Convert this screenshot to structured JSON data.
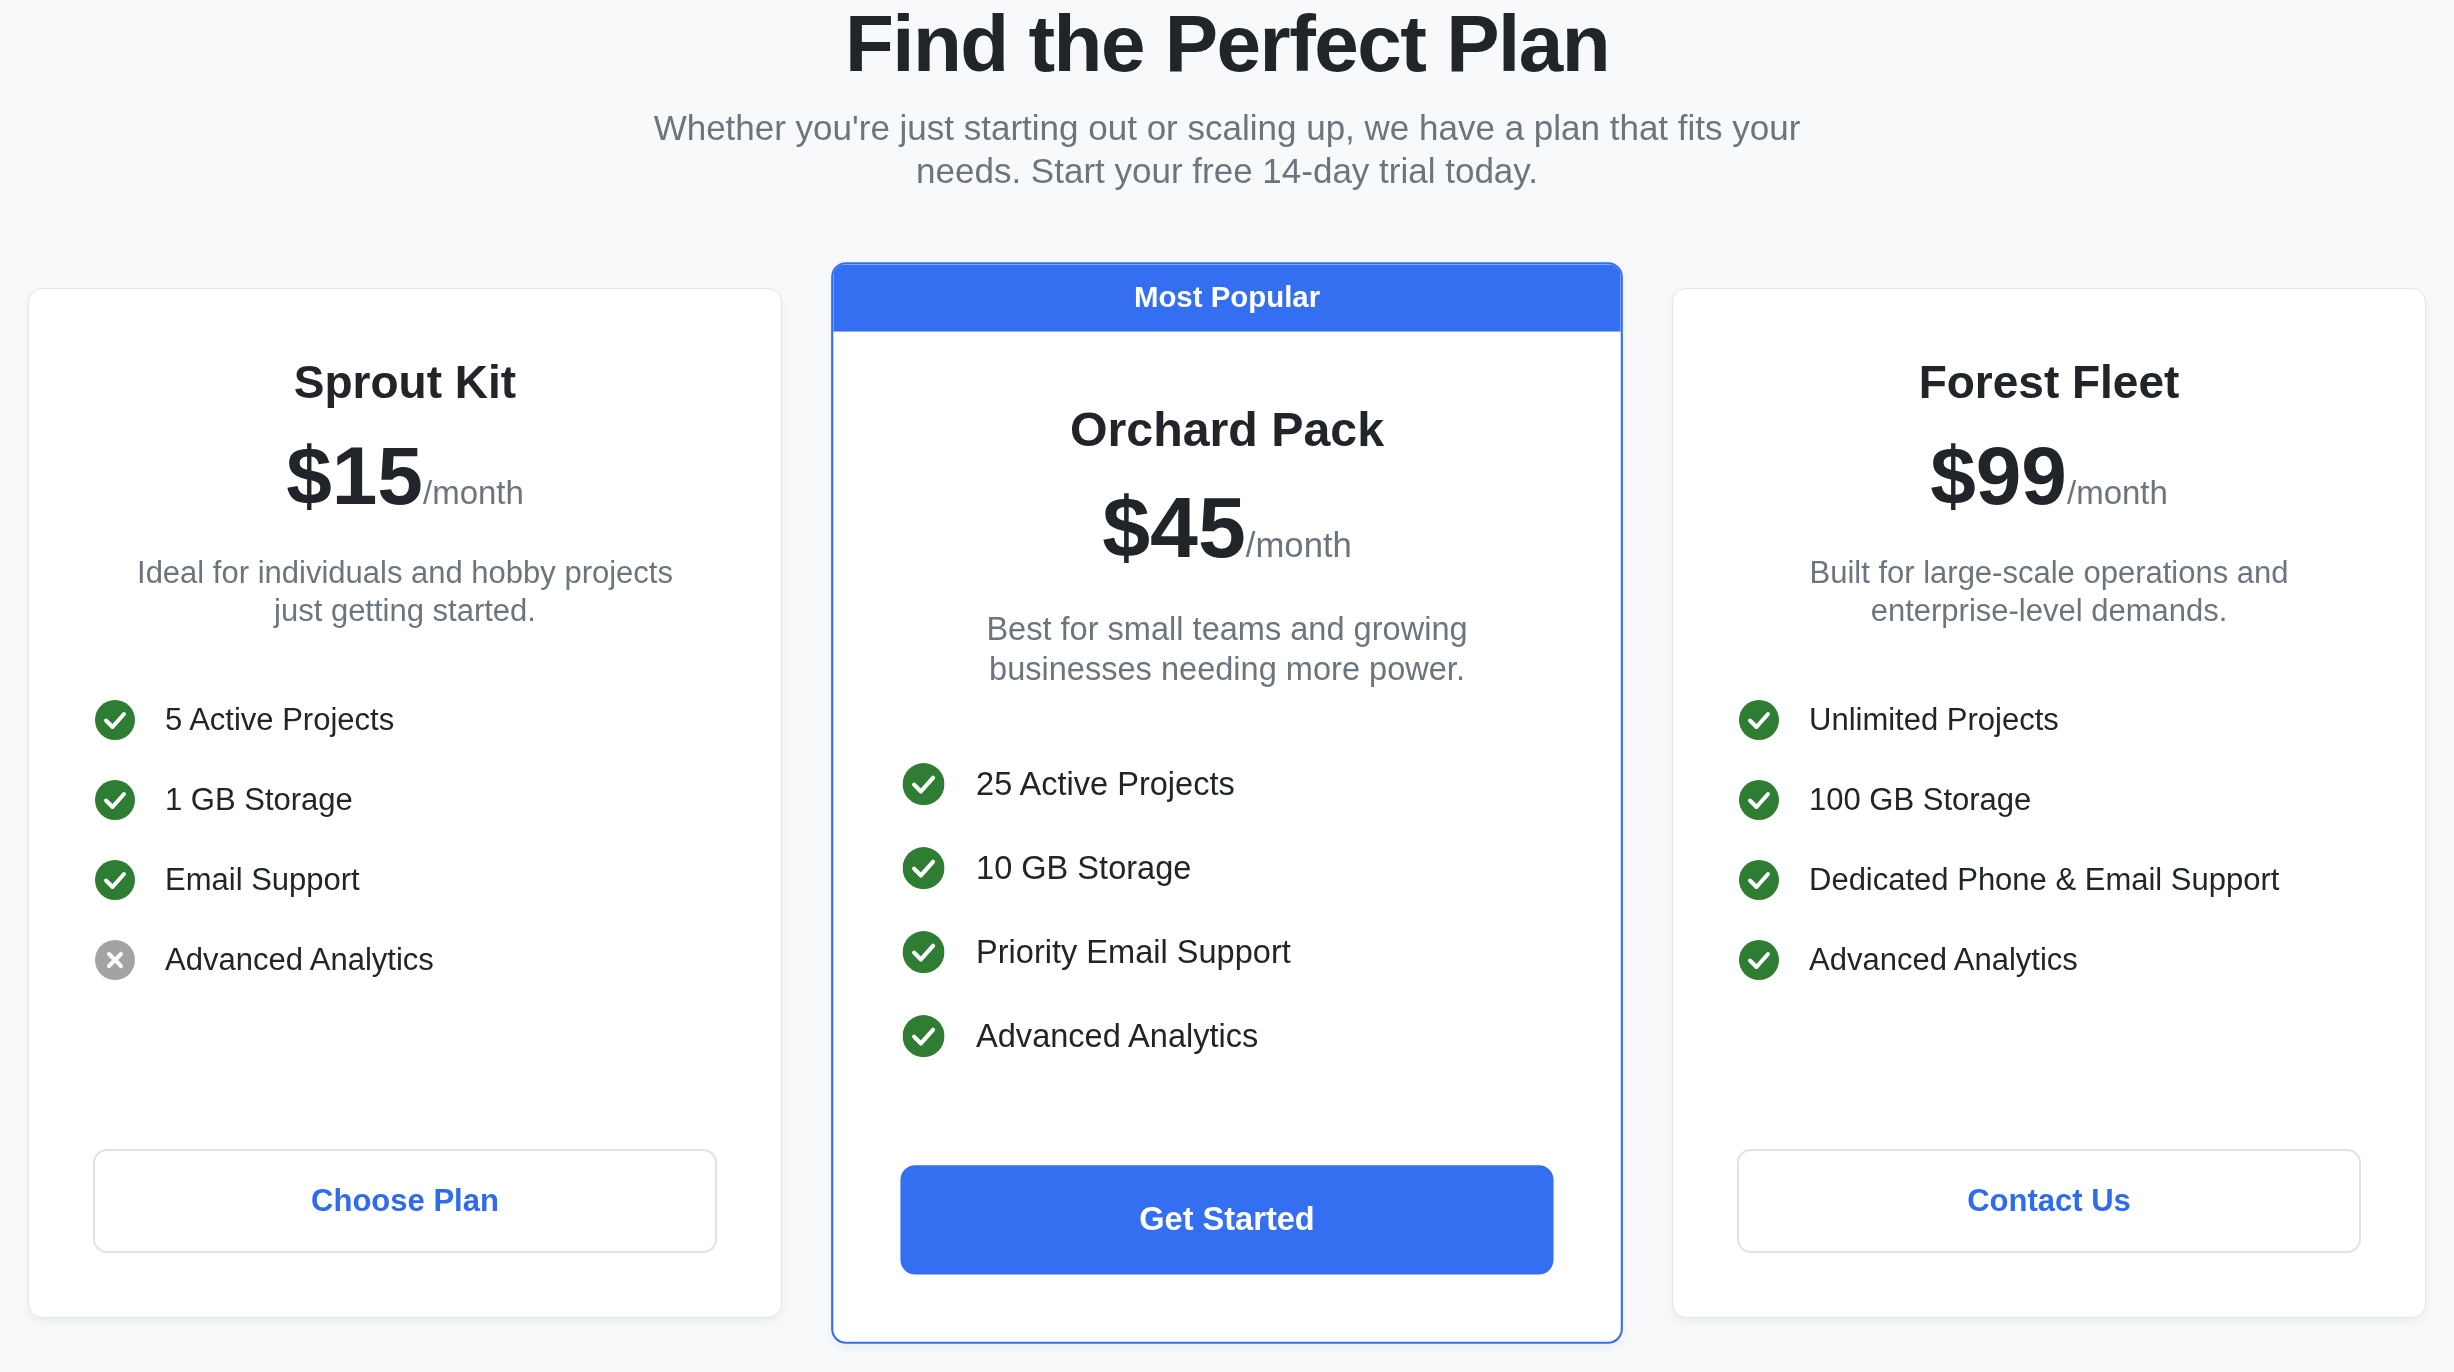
{
  "header": {
    "title": "Find the Perfect Plan",
    "subtitle": "Whether you're just starting out or scaling up, we have a plan that fits your needs. Start your free 14-day trial today."
  },
  "plans": [
    {
      "name": "Sprout Kit",
      "featured": false,
      "price": "$15",
      "period": "/month",
      "description": "Ideal for individuals and hobby projects just getting started.",
      "features": [
        {
          "label": "5 Active Projects",
          "included": true
        },
        {
          "label": "1 GB Storage",
          "included": true
        },
        {
          "label": "Email Support",
          "included": true
        },
        {
          "label": "Advanced Analytics",
          "included": false
        }
      ],
      "button": "Choose Plan"
    },
    {
      "badge": "Most Popular",
      "name": "Orchard Pack",
      "featured": true,
      "price": "$45",
      "period": "/month",
      "description": "Best for small teams and growing businesses needing more power.",
      "features": [
        {
          "label": "25 Active Projects",
          "included": true
        },
        {
          "label": "10 GB Storage",
          "included": true
        },
        {
          "label": "Priority Email Support",
          "included": true
        },
        {
          "label": "Advanced Analytics",
          "included": true
        }
      ],
      "button": "Get Started"
    },
    {
      "name": "Forest Fleet",
      "featured": false,
      "price": "$99",
      "period": "/month",
      "description": "Built for large-scale operations and enterprise-level demands.",
      "features": [
        {
          "label": "Unlimited Projects",
          "included": true
        },
        {
          "label": "100 GB Storage",
          "included": true
        },
        {
          "label": "Dedicated Phone & Email Support",
          "included": true
        },
        {
          "label": "Advanced Analytics",
          "included": true
        }
      ],
      "button": "Contact Us"
    }
  ]
}
